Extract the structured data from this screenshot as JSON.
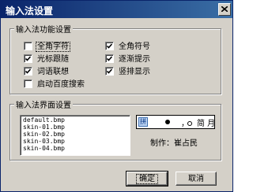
{
  "window": {
    "title": "输入法设置",
    "close_label": "×"
  },
  "function_group": {
    "label": "输入法功能设置",
    "options": [
      {
        "label": "全角字符",
        "checked": false
      },
      {
        "label": "光标跟随",
        "checked": true
      },
      {
        "label": "词语联想",
        "checked": true
      },
      {
        "label": "启动百度搜索",
        "checked": false
      },
      {
        "label": "全角符号",
        "checked": true
      },
      {
        "label": "逐渐提示",
        "checked": true
      },
      {
        "label": "竖排显示",
        "checked": true
      }
    ]
  },
  "skin_group": {
    "label": "输入法界面设置",
    "skins": [
      "default.bmp",
      "skin-01.bmp",
      "skin-02.bmp",
      "skin-03.bmp",
      "skin-04.bmp"
    ],
    "preview": {
      "left_char": "拼",
      "comma": "，",
      "right_text": "简 月"
    },
    "author_text": "制作：崔占民"
  },
  "buttons": {
    "ok": "确定",
    "cancel": "取消"
  },
  "colors": {
    "title_start": "#0a246a",
    "title_end": "#3a6ea5",
    "face": "#d4d0c8"
  }
}
